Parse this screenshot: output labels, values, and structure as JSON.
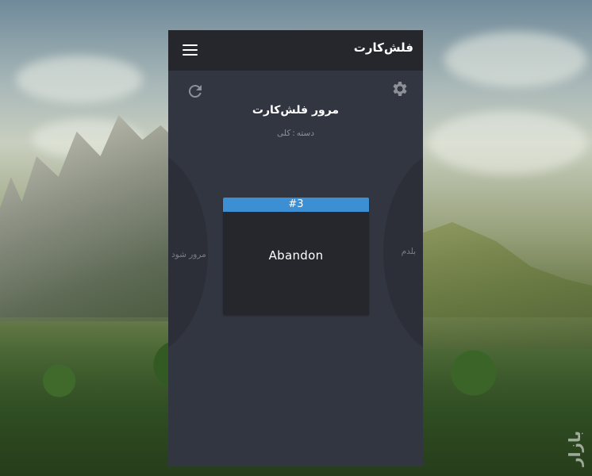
{
  "app": {
    "title": "فلش‌کارت",
    "menu_icon": "hamburger-menu-icon"
  },
  "toolbar": {
    "refresh_icon": "refresh-icon",
    "settings_icon": "gear-icon"
  },
  "review": {
    "title": "مرور فلش‌کارت",
    "category_label": "دسته",
    "category_separator": ":",
    "category_value": "کلی"
  },
  "actions": {
    "left_label": "مرور شود",
    "right_label": "بلدم"
  },
  "card": {
    "number": "#3",
    "word": "Abandon",
    "header_color": "#3d8fd3"
  },
  "watermark": {
    "text": "بازار"
  }
}
